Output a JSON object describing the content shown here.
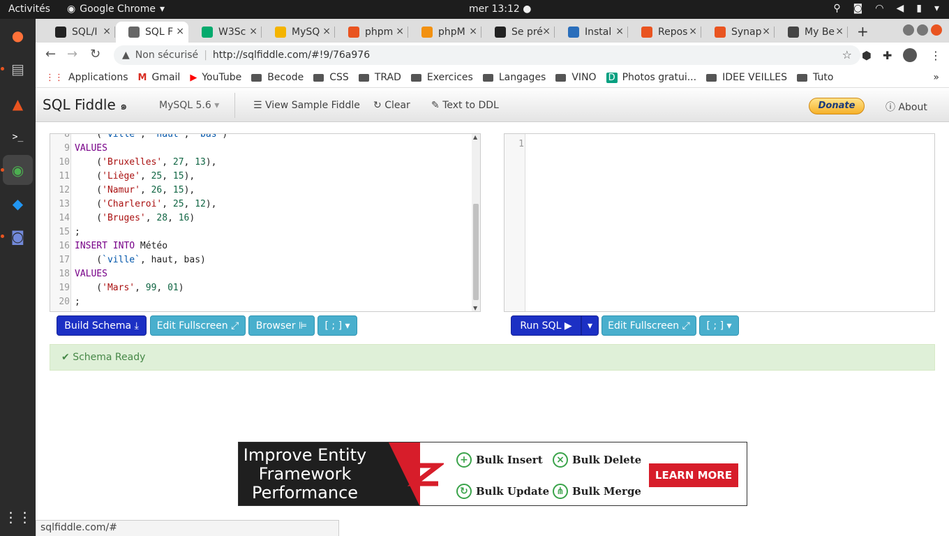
{
  "topbar": {
    "activities": "Activités",
    "app_name": "Google Chrome",
    "clock": "mer 13:12"
  },
  "tabs": [
    {
      "label": "SQL/I",
      "icon": "github-icon",
      "color": "#222222"
    },
    {
      "label": "SQL F",
      "icon": "sqlfiddle-icon",
      "color": "#666666",
      "active": true
    },
    {
      "label": "W3Sc",
      "icon": "w3schools-icon",
      "color": "#04aa6d"
    },
    {
      "label": "MySQ",
      "icon": "slides-icon",
      "color": "#f4b400"
    },
    {
      "label": "phpm",
      "icon": "ubuntu-icon",
      "color": "#e95420"
    },
    {
      "label": "phpM",
      "icon": "phpmyadmin-icon",
      "color": "#f29111"
    },
    {
      "label": "Se pré",
      "icon": "trello-icon",
      "color": "#222222"
    },
    {
      "label": "Instal",
      "icon": "browser-icon",
      "color": "#2a6ebb"
    },
    {
      "label": "Repos",
      "icon": "ubuntu-icon",
      "color": "#e95420"
    },
    {
      "label": "Synap",
      "icon": "ubuntu-icon",
      "color": "#e95420"
    },
    {
      "label": "My Be",
      "icon": "avatar-icon",
      "color": "#444444"
    }
  ],
  "omnibox": {
    "security": "Non sécurisé",
    "url": "http://sqlfiddle.com/#!9/76a976"
  },
  "bookmarks": [
    {
      "label": "Applications",
      "type": "apps"
    },
    {
      "label": "Gmail",
      "type": "gmail"
    },
    {
      "label": "YouTube",
      "type": "youtube"
    },
    {
      "label": "Becode",
      "type": "folder"
    },
    {
      "label": "CSS",
      "type": "folder"
    },
    {
      "label": "TRAD",
      "type": "folder"
    },
    {
      "label": "Exercices",
      "type": "folder"
    },
    {
      "label": "Langages",
      "type": "folder"
    },
    {
      "label": "VINO",
      "type": "folder"
    },
    {
      "label": "Photos gratui...",
      "type": "photos"
    },
    {
      "label": "IDEE VEILLES",
      "type": "folder"
    },
    {
      "label": "Tuto",
      "type": "folder"
    }
  ],
  "navbar": {
    "brand": "SQL Fiddle",
    "db": "MySQL 5.6",
    "view_sample": "View Sample Fiddle",
    "clear": "Clear",
    "text_to_ddl": "Text to DDL",
    "donate": "Donate",
    "about": "About"
  },
  "schema_lines": [
    {
      "n": "8",
      "tokens": [
        [
          "",
          "    ("
        ],
        [
          "bq",
          "`ville`"
        ],
        [
          "",
          ", "
        ],
        [
          "bq",
          "`haut`"
        ],
        [
          "",
          ", "
        ],
        [
          "bq",
          "`bas`"
        ],
        [
          "",
          ")"
        ]
      ]
    },
    {
      "n": "9",
      "tokens": [
        [
          "kw",
          "VALUES"
        ]
      ]
    },
    {
      "n": "10",
      "tokens": [
        [
          "",
          "    ("
        ],
        [
          "str",
          "'Bruxelles'"
        ],
        [
          "",
          ", "
        ],
        [
          "num",
          "27"
        ],
        [
          "",
          ", "
        ],
        [
          "num",
          "13"
        ],
        [
          "",
          "),"
        ]
      ]
    },
    {
      "n": "11",
      "tokens": [
        [
          "",
          "    ("
        ],
        [
          "str",
          "'Liège'"
        ],
        [
          "",
          ", "
        ],
        [
          "num",
          "25"
        ],
        [
          "",
          ", "
        ],
        [
          "num",
          "15"
        ],
        [
          "",
          "),"
        ]
      ]
    },
    {
      "n": "12",
      "tokens": [
        [
          "",
          "    ("
        ],
        [
          "str",
          "'Namur'"
        ],
        [
          "",
          ", "
        ],
        [
          "num",
          "26"
        ],
        [
          "",
          ", "
        ],
        [
          "num",
          "15"
        ],
        [
          "",
          "),"
        ]
      ]
    },
    {
      "n": "13",
      "tokens": [
        [
          "",
          "    ("
        ],
        [
          "str",
          "'Charleroi'"
        ],
        [
          "",
          ", "
        ],
        [
          "num",
          "25"
        ],
        [
          "",
          ", "
        ],
        [
          "num",
          "12"
        ],
        [
          "",
          "),"
        ]
      ]
    },
    {
      "n": "14",
      "tokens": [
        [
          "",
          "    ("
        ],
        [
          "str",
          "'Bruges'"
        ],
        [
          "",
          ", "
        ],
        [
          "num",
          "28"
        ],
        [
          "",
          ", "
        ],
        [
          "num",
          "16"
        ],
        [
          "",
          ")"
        ]
      ]
    },
    {
      "n": "15",
      "tokens": [
        [
          "",
          ";"
        ]
      ]
    },
    {
      "n": "16",
      "tokens": [
        [
          "kw",
          "INSERT INTO"
        ],
        [
          "",
          " Météo"
        ]
      ]
    },
    {
      "n": "17",
      "tokens": [
        [
          "",
          "    ("
        ],
        [
          "bq",
          "`ville`"
        ],
        [
          "",
          ", haut, bas)"
        ]
      ]
    },
    {
      "n": "18",
      "tokens": [
        [
          "kw",
          "VALUES"
        ]
      ]
    },
    {
      "n": "19",
      "tokens": [
        [
          "",
          "    ("
        ],
        [
          "str",
          "'Mars'"
        ],
        [
          "",
          ", "
        ],
        [
          "num",
          "99"
        ],
        [
          "",
          ", "
        ],
        [
          "num",
          "01"
        ],
        [
          "",
          ")"
        ]
      ]
    },
    {
      "n": "20",
      "tokens": [
        [
          "",
          ";"
        ]
      ]
    }
  ],
  "sql_lines": [
    {
      "n": "1",
      "tokens": []
    }
  ],
  "schema_buttons": {
    "build": "Build Schema",
    "fullscreen": "Edit Fullscreen",
    "browser": "Browser",
    "delimiter": "[ ; ]"
  },
  "sql_buttons": {
    "run": "Run SQL",
    "fullscreen": "Edit Fullscreen",
    "delimiter": "[ ; ]"
  },
  "status": "Schema Ready",
  "ad": {
    "headline": "Improve Entity Framework Performance",
    "features": [
      "Bulk Insert",
      "Bulk Delete",
      "Bulk Update",
      "Bulk Merge"
    ],
    "cta": "LEARN MORE"
  },
  "statusbar": "sqlfiddle.com/#"
}
